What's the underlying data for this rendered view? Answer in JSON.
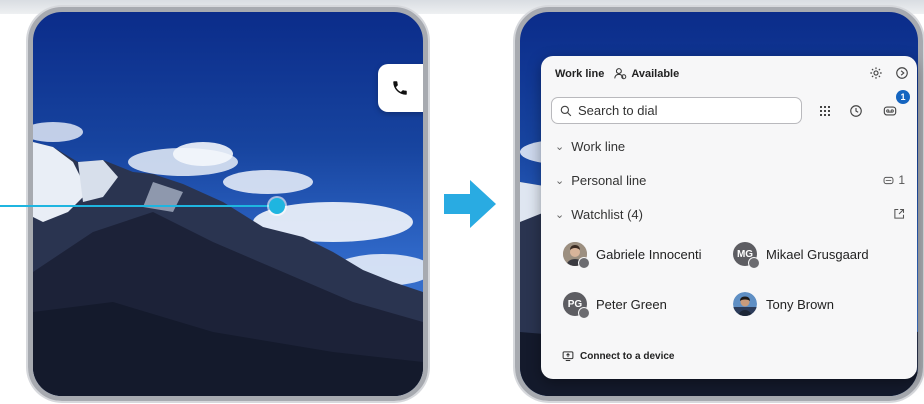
{
  "colors": {
    "accent": "#1fb5e0",
    "badge": "#1565c0",
    "frame": "#a7aab0"
  },
  "left_scene": {
    "call_icon": "phone-icon"
  },
  "panel": {
    "line_label": "Work line",
    "availability": "Available",
    "availability_icon": "presence-icon",
    "header_icons": [
      "gear-icon",
      "help-icon"
    ],
    "search": {
      "placeholder": "Search to dial",
      "value": ""
    },
    "toolbar_icons": [
      "dialpad-icon",
      "history-icon",
      "voicemail-icon"
    ],
    "voicemail_badge": "1",
    "sections": [
      {
        "label": "Work line"
      },
      {
        "label": "Personal line",
        "right_count": "1"
      },
      {
        "label": "Watchlist (4)"
      }
    ],
    "contacts": [
      {
        "name": "Gabriele Innocenti",
        "initials": ""
      },
      {
        "name": "Mikael Grusgaard",
        "initials": "MG"
      },
      {
        "name": "Peter Green",
        "initials": "PG"
      },
      {
        "name": "Tony Brown",
        "initials": ""
      }
    ],
    "connect_label": "Connect to a device"
  }
}
